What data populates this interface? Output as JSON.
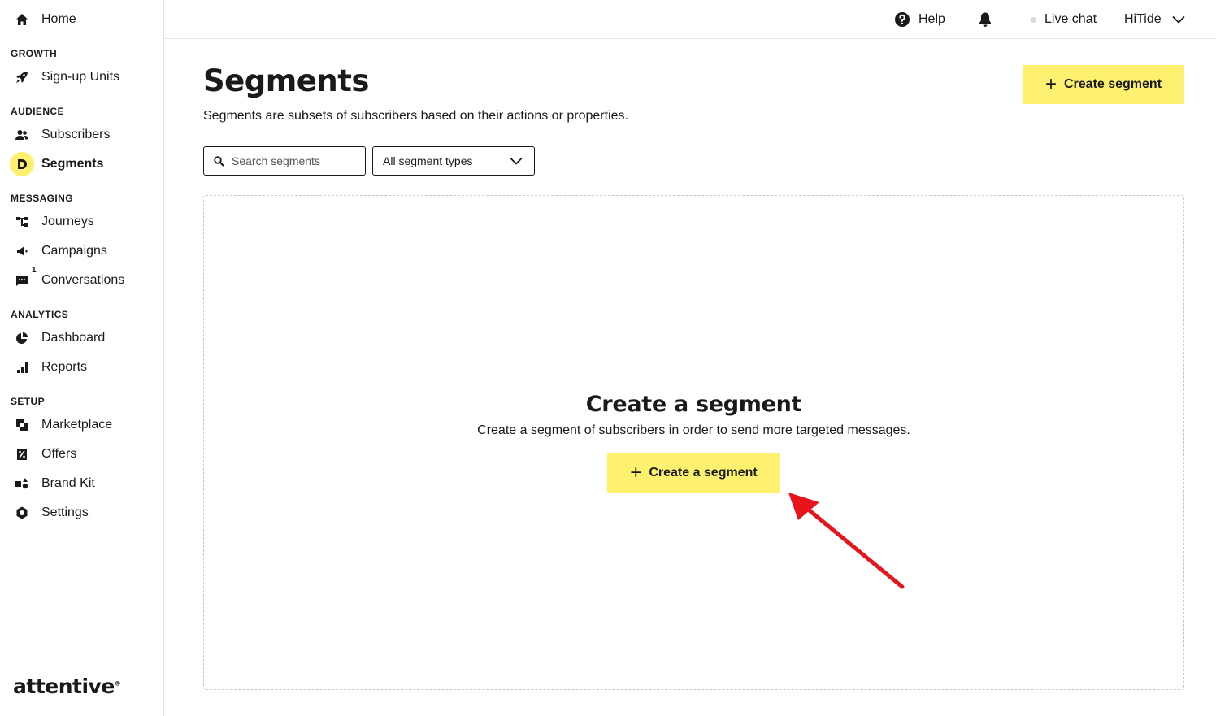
{
  "sidebar": {
    "home": "Home",
    "sections": {
      "growth": "GROWTH",
      "audience": "AUDIENCE",
      "messaging": "MESSAGING",
      "analytics": "ANALYTICS",
      "setup": "SETUP"
    },
    "items": {
      "signup_units": "Sign-up Units",
      "subscribers": "Subscribers",
      "segments": "Segments",
      "journeys": "Journeys",
      "campaigns": "Campaigns",
      "conversations": "Conversations",
      "conversations_badge": "1",
      "dashboard": "Dashboard",
      "reports": "Reports",
      "marketplace": "Marketplace",
      "offers": "Offers",
      "brand_kit": "Brand Kit",
      "settings": "Settings"
    },
    "active": "segments",
    "logo": "attentive"
  },
  "topbar": {
    "help": "Help",
    "live_chat": "Live chat",
    "account": "HiTide"
  },
  "main": {
    "title": "Segments",
    "subtitle": "Segments are subsets of subscribers based on their actions or properties.",
    "create_button": "Create segment",
    "search_placeholder": "Search segments",
    "filter_value": "All segment types",
    "empty_title": "Create a segment",
    "empty_subtitle": "Create a segment of subscribers in order to send more targeted messages.",
    "empty_button": "Create a segment"
  },
  "colors": {
    "accent": "#fff170",
    "annotation_arrow": "#e8141b"
  }
}
